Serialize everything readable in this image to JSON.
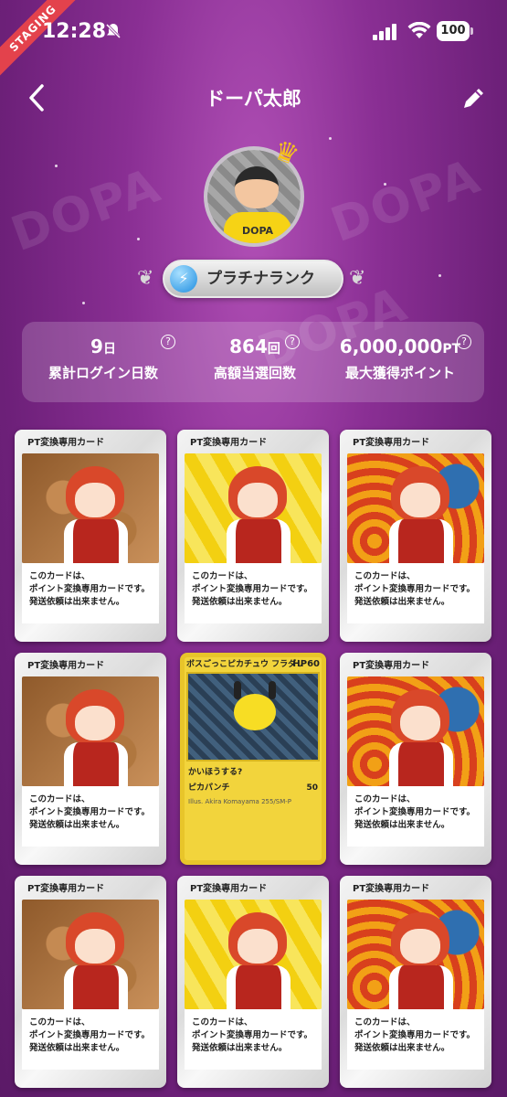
{
  "status_bar": {
    "time": "12:28",
    "battery": "100",
    "staging_label": "STAGING"
  },
  "header": {
    "title": "ドーパ太郎"
  },
  "profile": {
    "avatar_text": "DOPA",
    "rank": "プラチナランク"
  },
  "stats": [
    {
      "value": "9",
      "unit": "日",
      "label": "累計ログイン日数"
    },
    {
      "value": "864",
      "unit": "回",
      "label": "高額当選回数"
    },
    {
      "value": "6,000,000",
      "unit": "PT",
      "label": "最大獲得ポイント"
    }
  ],
  "card_common": {
    "header": "PT変換専用カード",
    "line1": "このカードは、",
    "line2": "ポイント変換専用カードです。",
    "line3": "発送依頼は出来ません。"
  },
  "pokemon_card": {
    "name": "ボスごっこピカチュウ フラダリ",
    "hp": "HP60",
    "ability": "かいほうする?",
    "attack": "ピカパンチ",
    "damage": "50",
    "footer": "Illus. Akira Komayama 255/SM-P"
  },
  "colors": {
    "bg_top": "#b04fb5",
    "bg_bottom": "#5b1a67",
    "rank_icon": "#1e8de0",
    "staging": "#e3424c"
  },
  "watermark": "DOPA"
}
